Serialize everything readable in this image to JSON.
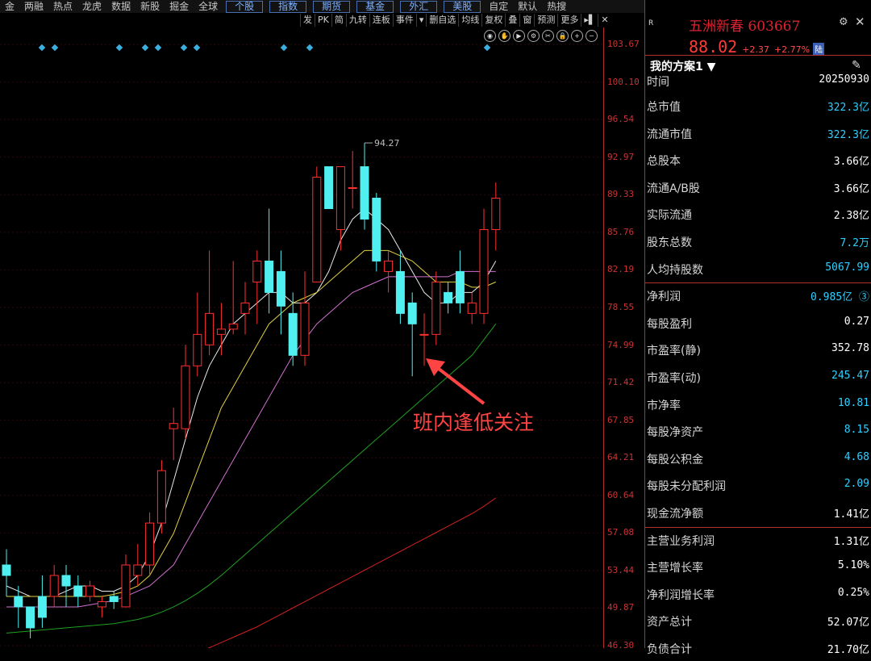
{
  "nav": [
    "金",
    "两融",
    "热点",
    "龙虎",
    "数据",
    "新股",
    "掘金",
    "全球",
    "个股",
    "指数",
    "期货",
    "基金",
    "外汇",
    "美股",
    "自定",
    "默认",
    "热搜"
  ],
  "toolbar": [
    "发",
    "PK",
    "简",
    "九转",
    "连板",
    "事件",
    "▾",
    "删自选",
    "均线",
    "复权",
    "叠",
    "窗",
    "预测",
    "更多",
    "▸▌",
    "✕"
  ],
  "icons": [
    "eye-icon",
    "hand-icon",
    "play-icon",
    "gear-icon",
    "scissors-icon",
    "lock-icon",
    "zoom-in-icon",
    "zoom-out-icon"
  ],
  "price_ticks": [
    "103.67",
    "100.10",
    "96.54",
    "92.97",
    "89.33",
    "85.76",
    "82.19",
    "78.55",
    "74.99",
    "71.42",
    "67.85",
    "64.21",
    "60.64",
    "57.08",
    "53.44",
    "49.87",
    "46.30"
  ],
  "high_label": "94.27",
  "annotation": "班内逢低关注",
  "stock": {
    "title": "五洲新春 603667",
    "price": "88.02",
    "change": "+2.37",
    "pct": "+2.77%",
    "badge": "陆",
    "r_mark": "R"
  },
  "plan_title": "我的方案1 ▼",
  "metrics": [
    {
      "label": "时间",
      "value": "20250930",
      "color": "#ffffff"
    },
    {
      "label": "总市值",
      "value": "322.3亿",
      "color": "#2fd0ff"
    },
    {
      "label": "流通市值",
      "value": "322.3亿",
      "color": "#2fd0ff"
    },
    {
      "label": "总股本",
      "value": "3.66亿",
      "color": "#ffffff"
    },
    {
      "label": "流通A/B股",
      "value": "3.66亿",
      "color": "#ffffff"
    },
    {
      "label": "实际流通",
      "value": "2.38亿",
      "color": "#ffffff"
    },
    {
      "label": "股东总数",
      "value": "7.2万",
      "color": "#2fd0ff"
    },
    {
      "label": "人均持股数",
      "value": "5067.99",
      "color": "#2fd0ff"
    },
    {
      "label": "净利润",
      "value": "0.985亿 ③",
      "color": "#2fd0ff"
    },
    {
      "label": "每股盈利",
      "value": "0.27",
      "color": "#ffffff"
    },
    {
      "label": "市盈率(静)",
      "value": "352.78",
      "color": "#ffffff"
    },
    {
      "label": "市盈率(动)",
      "value": "245.47",
      "color": "#2fd0ff"
    },
    {
      "label": "市净率",
      "value": "10.81",
      "color": "#2fd0ff"
    },
    {
      "label": "每股净资产",
      "value": "8.15",
      "color": "#2fd0ff"
    },
    {
      "label": "每股公积金",
      "value": "4.68",
      "color": "#2fd0ff"
    },
    {
      "label": "每股未分配利润",
      "value": "2.09",
      "color": "#2fd0ff"
    },
    {
      "label": "现金流净额",
      "value": "1.41亿",
      "color": "#ffffff"
    },
    {
      "label": "主营业务利润",
      "value": "1.31亿",
      "color": "#ffffff"
    },
    {
      "label": "主营增长率",
      "value": "5.10%",
      "color": "#ffffff"
    },
    {
      "label": "净利润增长率",
      "value": "0.25%",
      "color": "#ffffff"
    },
    {
      "label": "资产总计",
      "value": "52.07亿",
      "color": "#ffffff"
    },
    {
      "label": "负债合计",
      "value": "21.70亿",
      "color": "#ffffff"
    }
  ],
  "chart_data": {
    "type": "candlestick",
    "y_range": [
      46.3,
      103.67
    ],
    "candles": [
      [
        54,
        53,
        55.5,
        51
      ],
      [
        51,
        50,
        52,
        48
      ],
      [
        50,
        48,
        50,
        47
      ],
      [
        51,
        49,
        53,
        48
      ],
      [
        51,
        53,
        54,
        50
      ],
      [
        53,
        52,
        54,
        50
      ],
      [
        52,
        51,
        53,
        50
      ],
      [
        51,
        52,
        52.5,
        50.5
      ],
      [
        50,
        50.5,
        51,
        49
      ],
      [
        51,
        50.5,
        51.5,
        49.8
      ],
      [
        50,
        54,
        55,
        50
      ],
      [
        53,
        54,
        56,
        52
      ],
      [
        54,
        58,
        59,
        53
      ],
      [
        58,
        63,
        64,
        57
      ],
      [
        67,
        67.5,
        69,
        64
      ],
      [
        67,
        73,
        75,
        66
      ],
      [
        73,
        76,
        80,
        72
      ],
      [
        75,
        78,
        84,
        74
      ],
      [
        76,
        76.5,
        79,
        74
      ],
      [
        76.5,
        77,
        83,
        76
      ],
      [
        78,
        79,
        81,
        76
      ],
      [
        81,
        83,
        84,
        77
      ],
      [
        83,
        80,
        88,
        78
      ],
      [
        82,
        78.7,
        84,
        76
      ],
      [
        78,
        74,
        80,
        73
      ],
      [
        74,
        79,
        82,
        73
      ],
      [
        81,
        91,
        92,
        81
      ],
      [
        92,
        88,
        92,
        88
      ],
      [
        86,
        92,
        92,
        84
      ],
      [
        90,
        90,
        93.5,
        88
      ],
      [
        92,
        87,
        94.27,
        86
      ],
      [
        89,
        83,
        89.5,
        82
      ],
      [
        82,
        83,
        84,
        80
      ],
      [
        82,
        78,
        84,
        77
      ],
      [
        79,
        77,
        80,
        72
      ],
      [
        76,
        76,
        78,
        73
      ],
      [
        76,
        81,
        82,
        75
      ],
      [
        80,
        79,
        81,
        78
      ],
      [
        82,
        79,
        84,
        78
      ],
      [
        78,
        79,
        80,
        77
      ],
      [
        78,
        86,
        88,
        77
      ],
      [
        86,
        89,
        90.5,
        84
      ]
    ],
    "ma": {
      "white": [
        52,
        51.5,
        51,
        51,
        51,
        51.5,
        52,
        52,
        51.5,
        51.5,
        52,
        53,
        55,
        58,
        62,
        66,
        70,
        73,
        75,
        77,
        78,
        79,
        80,
        80,
        79,
        79,
        80,
        82,
        85,
        87,
        88,
        87,
        86,
        84,
        82,
        80,
        79,
        79,
        80,
        80,
        81,
        83
      ],
      "yellow": [
        51,
        51,
        51,
        51,
        51,
        51,
        51,
        51,
        51,
        51.2,
        51.5,
        52,
        53,
        55,
        57,
        60,
        63,
        66,
        69,
        71,
        73,
        75,
        77,
        78,
        79,
        79.5,
        80,
        81,
        82,
        83,
        84,
        84,
        84,
        83.5,
        83,
        82,
        81,
        81,
        81,
        80.5,
        80.5,
        81
      ],
      "magenta": [
        50,
        50,
        50,
        50,
        50,
        50,
        50,
        50.2,
        50.4,
        50.6,
        51,
        51.5,
        52,
        53,
        54,
        56,
        58,
        60,
        62,
        64,
        66,
        68,
        70,
        72,
        74,
        75.5,
        77,
        78,
        79,
        80,
        80.5,
        81,
        81.5,
        81.5,
        81.5,
        81.5,
        81.5,
        81.5,
        82,
        82,
        82,
        82
      ],
      "green": [
        47.5,
        47.6,
        47.7,
        47.8,
        47.9,
        48,
        48.1,
        48.2,
        48.3,
        48.4,
        48.6,
        48.8,
        49.1,
        49.5,
        50,
        50.6,
        51.3,
        52.1,
        53,
        54,
        55,
        56,
        57,
        58,
        59,
        60,
        61,
        62,
        63,
        64,
        65,
        66,
        67,
        68,
        69,
        70,
        71,
        72,
        73,
        74,
        75.5,
        77
      ],
      "red": [
        43,
        43.1,
        43.2,
        43.3,
        43.4,
        43.5,
        43.6,
        43.7,
        43.8,
        43.9,
        44,
        44.2,
        44.4,
        44.7,
        45,
        45.3,
        45.7,
        46.1,
        46.6,
        47.1,
        47.6,
        48.1,
        48.7,
        49.3,
        49.9,
        50.5,
        51.1,
        51.7,
        52.3,
        52.9,
        53.5,
        54.1,
        54.7,
        55.3,
        55.9,
        56.5,
        57.1,
        57.7,
        58.3,
        58.9,
        59.6,
        60.4
      ]
    }
  }
}
